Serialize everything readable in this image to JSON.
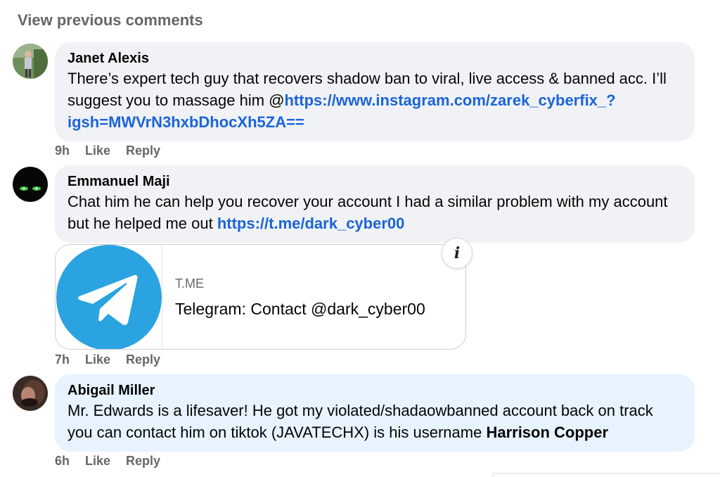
{
  "view_previous": "View previous comments",
  "comments": [
    {
      "author": "Janet Alexis",
      "text_part1": "There’s expert tech guy that recovers shadow ban to viral, live access & banned acc. I’ll suggest you to massage him @",
      "link": "https://www.instagram.com/zarek_cyberfix_?igsh=MWVrN3hxbDhocXh5ZA==",
      "time": "9h",
      "like": "Like",
      "reply": "Reply"
    },
    {
      "author": "Emmanuel Maji",
      "text_part1": "Chat him he can help you recover your account I had a similar problem with my account but he helped me out ",
      "link": "https://t.me/dark_cyber00",
      "time": "7h",
      "like": "Like",
      "reply": "Reply",
      "link_preview": {
        "domain": "T.ME",
        "title": "Telegram: Contact @dark_cyber00",
        "info_icon": "info-icon",
        "info_label": "i"
      }
    },
    {
      "author": "Abigail Miller",
      "text_part1": "Mr. Edwards is a lifesaver! He got my violated/shadaowbanned account back on track you can contact him on tiktok (JAVATECHX) is his username ",
      "bold_mention": "Harrison Copper",
      "time": "6h",
      "like": "Like",
      "reply": "Reply"
    }
  ],
  "colors": {
    "bubble": "#f0f2f5",
    "bubble_highlight": "#e7f3ff",
    "link": "#1b64d8",
    "meta": "#65676b",
    "telegram": "#2aa3e0"
  }
}
